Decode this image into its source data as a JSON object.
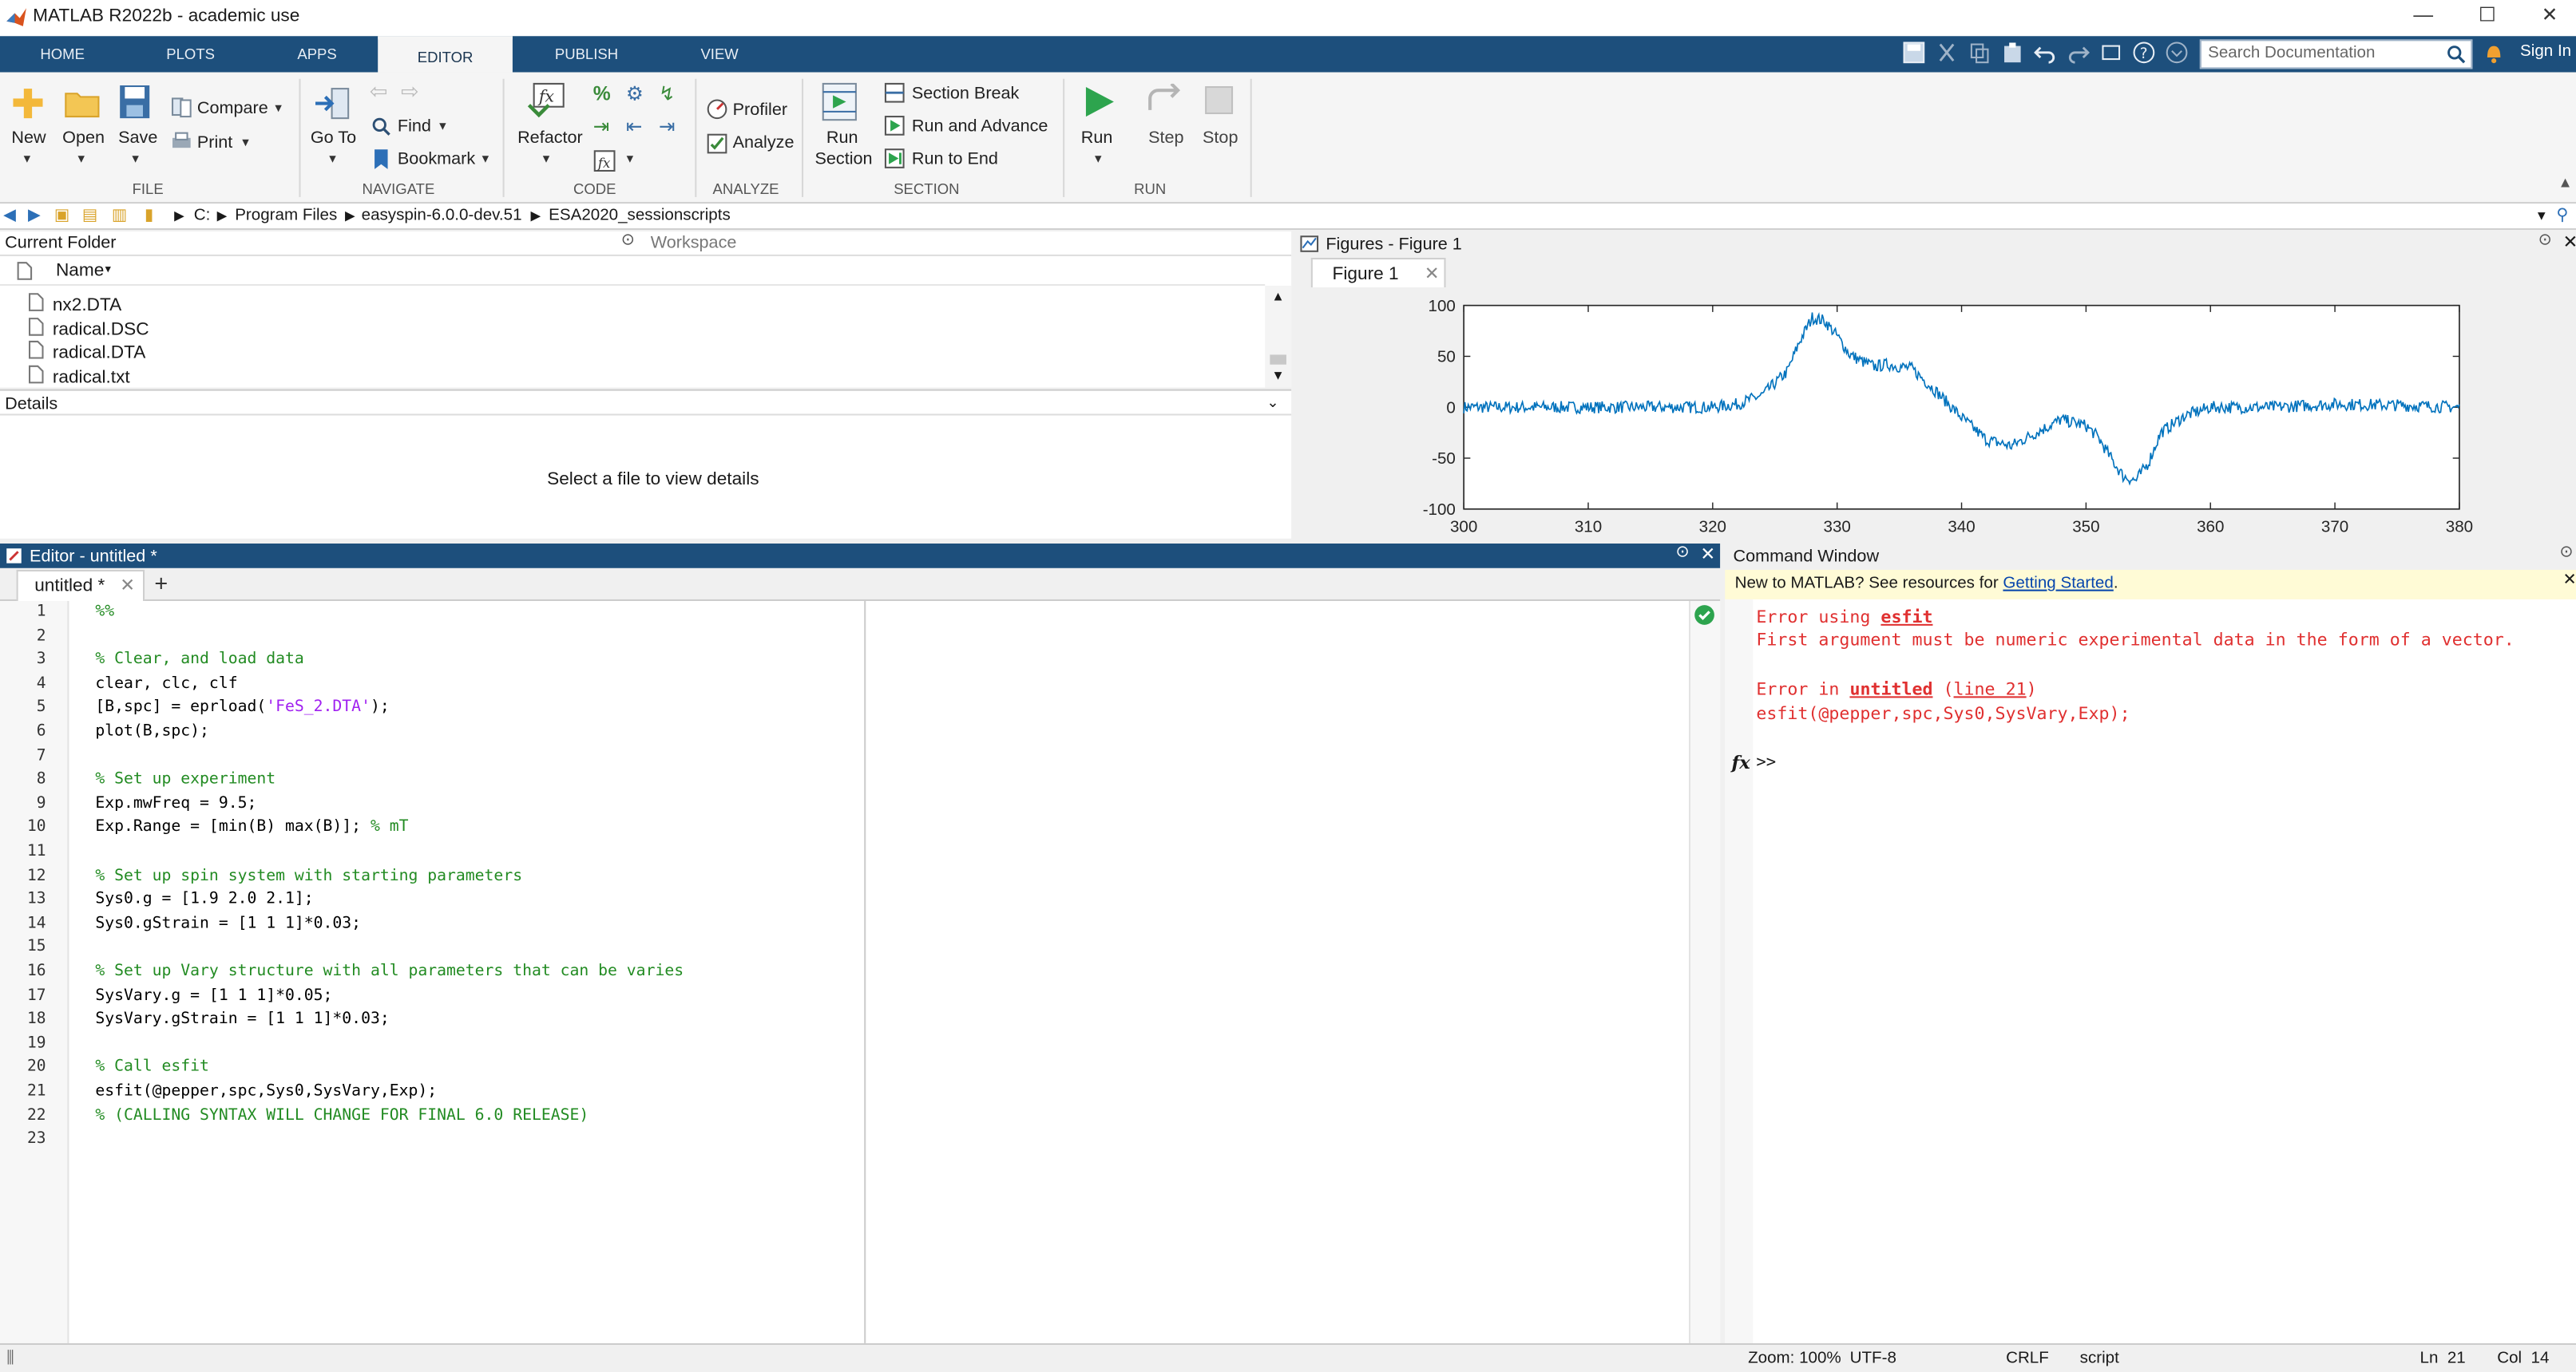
{
  "window": {
    "title": "MATLAB R2022b - academic use",
    "minimize": "—",
    "maximize": "☐",
    "close": "✕"
  },
  "tabs": [
    "HOME",
    "PLOTS",
    "APPS",
    "EDITOR",
    "PUBLISH",
    "VIEW"
  ],
  "active_tab": "EDITOR",
  "search": {
    "placeholder": "Search Documentation"
  },
  "signin": "Sign In",
  "ribbon": {
    "file": {
      "caption": "FILE",
      "new": "New",
      "open": "Open",
      "save": "Save",
      "compare": "Compare",
      "print": "Print"
    },
    "navigate": {
      "caption": "NAVIGATE",
      "goto": "Go To",
      "find": "Find",
      "bookmark": "Bookmark"
    },
    "code": {
      "caption": "CODE",
      "refactor": "Refactor"
    },
    "analyze": {
      "caption": "ANALYZE",
      "profiler": "Profiler",
      "analyze": "Analyze"
    },
    "section": {
      "caption": "SECTION",
      "run_section_1": "Run",
      "run_section_2": "Section",
      "section_break": "Section Break",
      "run_advance": "Run and Advance",
      "run_end": "Run to End"
    },
    "run": {
      "caption": "RUN",
      "run": "Run",
      "step": "Step",
      "stop": "Stop"
    }
  },
  "address": {
    "path": [
      "C:",
      "Program Files",
      "easyspin-6.0.0-dev.51",
      "ESA2020_sessionscripts"
    ]
  },
  "current_folder": {
    "title": "Current Folder",
    "workspace_tab": "Workspace",
    "column": "Name",
    "files": [
      "nx2.DTA",
      "radical.DSC",
      "radical.DTA",
      "radical.txt"
    ],
    "details_title": "Details",
    "details_msg": "Select a file to view details"
  },
  "figure": {
    "title": "Figures - Figure 1",
    "tab": "Figure 1",
    "y_ticks": [
      "100",
      "50",
      "0",
      "-50",
      "-100"
    ],
    "x_ticks": [
      "300",
      "310",
      "320",
      "330",
      "340",
      "350",
      "360",
      "370",
      "380"
    ],
    "line_color": "#0072bd"
  },
  "chart_data": {
    "type": "line",
    "xlim": [
      300,
      380
    ],
    "ylim": [
      -100,
      100
    ],
    "series": [
      {
        "x": [
          300,
          305,
          310,
          315,
          320,
          322,
          324,
          326,
          327,
          328,
          329,
          330,
          331,
          332,
          333,
          334,
          336,
          338,
          340,
          342,
          344,
          346,
          348,
          350,
          351,
          352,
          353,
          354,
          355,
          356,
          358,
          360,
          365,
          370,
          375,
          380
        ],
        "values": [
          0,
          0,
          0,
          0,
          0,
          3,
          12,
          35,
          65,
          88,
          85,
          70,
          52,
          45,
          40,
          42,
          38,
          15,
          -10,
          -32,
          -38,
          -25,
          -12,
          -18,
          -30,
          -50,
          -68,
          -72,
          -55,
          -25,
          -8,
          0,
          0,
          3,
          2,
          0
        ]
      }
    ]
  },
  "editor": {
    "title": "Editor - untitled *",
    "tab": "untitled *",
    "add_tab": "+",
    "lines": [
      "%%",
      "",
      "% Clear, and load data",
      "clear, clc, clf",
      "[B,spc] = eprload('FeS_2.DTA');",
      "plot(B,spc);",
      "",
      "% Set up experiment",
      "Exp.mwFreq = 9.5;",
      "Exp.Range = [min(B) max(B)]; % mT",
      "",
      "% Set up spin system with starting parameters",
      "Sys0.g = [1.9 2.0 2.1];",
      "Sys0.gStrain = [1 1 1]*0.03;",
      "",
      "% Set up Vary structure with all parameters that can be varies",
      "SysVary.g = [1 1 1]*0.05;",
      "SysVary.gStrain = [1 1 1]*0.03;",
      "",
      "% Call esfit",
      "esfit(@pepper,spc,Sys0,SysVary,Exp);",
      "% (CALLING SYNTAX WILL CHANGE FOR FINAL 6.0 RELEASE)",
      ""
    ]
  },
  "command_window": {
    "title": "Command Window",
    "new_msg": "New to MATLAB? See resources for ",
    "new_link": "Getting Started",
    "new_end": ".",
    "err1_a": "Error using ",
    "err1_b": "esfit",
    "err2": "First argument must be numeric experimental data in the form of a vector.",
    "err3_a": "Error in ",
    "err3_b": "untitled",
    "err3_c": " (",
    "err3_d": "line 21",
    "err3_e": ")",
    "err4": "esfit(@pepper,spc,Sys0,SysVary,Exp);",
    "prompt": ">>",
    "fx": "fx"
  },
  "status": {
    "zoom": "Zoom: 100%",
    "encoding": "UTF-8",
    "eol": "CRLF",
    "type": "script",
    "ln": "Ln  21",
    "col": "Col  14"
  }
}
